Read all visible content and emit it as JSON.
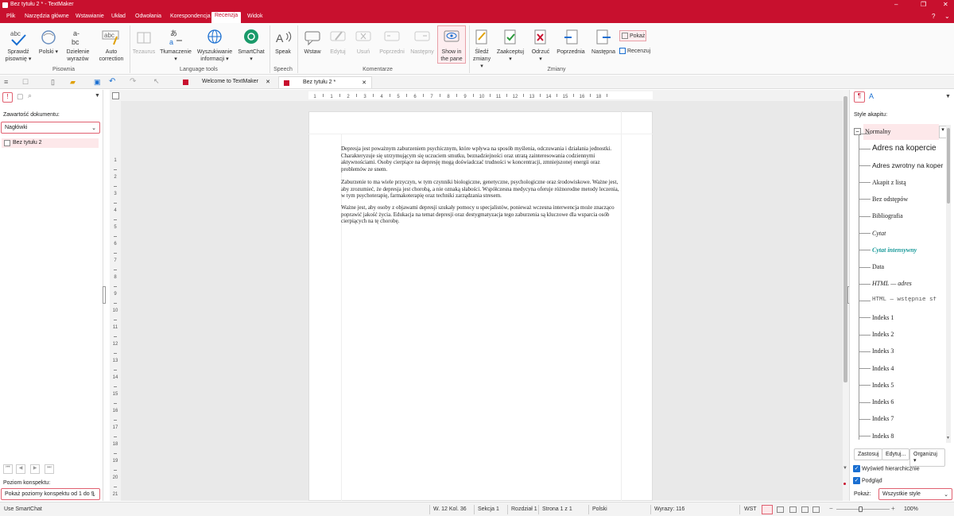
{
  "window": {
    "title": "Bez tytułu 2 * - TextMaker"
  },
  "menu": {
    "tabs": [
      "Plik",
      "Narzędzia główne",
      "Wstawianie",
      "Układ",
      "Odwołania",
      "Korespondencja",
      "Recenzja",
      "Widok"
    ],
    "active": "Recenzja"
  },
  "ribbon": {
    "proofing": {
      "spell_check": "Sprawdź pisownię",
      "language": "Polski",
      "hyphenation": "Dzielenie wyrazów",
      "autocorrect": "Auto correction",
      "group": "Pisownia"
    },
    "language_tools": {
      "thesaurus": "Tezaurus",
      "translate": "Tłumaczenie",
      "research": "Wyszukiwanie informacji",
      "smartchat": "SmartChat",
      "group": "Language tools"
    },
    "speech": {
      "speak": "Speak",
      "group": "Speech"
    },
    "comments": {
      "insert": "Wstaw",
      "edit": "Edytuj",
      "delete": "Usuń",
      "previous": "Poprzedni",
      "next": "Następny",
      "show_in_pane": "Show in the pane",
      "group": "Komentarze"
    },
    "changes": {
      "track": "Śledź zmiany",
      "accept": "Zaakceptuj",
      "reject": "Odrzuć",
      "previous": "Poprzednia",
      "next": "Następna",
      "show": "Pokaż",
      "review": "Recenzuj",
      "group": "Zmiany"
    }
  },
  "tabs": {
    "welcome": "Welcome to TextMaker",
    "doc": "Bez tytułu 2 *"
  },
  "left_panel": {
    "content_label": "Zawartość dokumentu:",
    "content_select": "Nagłówki",
    "tree_item": "Bez tytułu 2",
    "outline_label": "Poziom konspektu:",
    "outline_select": "Pokaż poziomy konspektu od 1 do 9"
  },
  "ruler": {
    "h_labels": [
      "1",
      "1",
      "2",
      "3",
      "4",
      "5",
      "6",
      "7",
      "8",
      "9",
      "10",
      "11",
      "12",
      "13",
      "14",
      "15",
      "16",
      "18"
    ],
    "v_labels": [
      "1",
      "2",
      "3",
      "4",
      "5",
      "6",
      "7",
      "8",
      "9",
      "10",
      "11",
      "12",
      "13",
      "14",
      "15",
      "16",
      "17",
      "18",
      "19",
      "20",
      "21"
    ]
  },
  "document": {
    "paragraphs": [
      "Depresja jest poważnym zaburzeniem psychicznym, które wpływa na sposób myślenia, odczuwania i działania jednostki. Charakteryzuje się utrzymującym się uczuciem smutku, beznadziejności oraz utratą zainteresowania codziennymi aktywnościami. Osoby cierpiące na depresję mogą doświadczać trudności w koncentracji, zmniejszonej energii oraz problemów ze snem.",
      "Zaburzenie to ma wiele przyczyn, w tym czynniki biologiczne, genetyczne, psychologiczne oraz środowiskowe. Ważne jest, aby zrozumieć, że depresja jest chorobą, a nie oznaką słabości. Współczesna medycyna oferuje różnorodne metody leczenia, w tym psychoterapię, farmakoterapię oraz techniki zarządzania stresem.",
      "Ważne jest, aby osoby z objawami depresji szukały pomocy u specjalistów, ponieważ wczesna interwencja może znacząco poprawić jakość życia. Edukacja na temat depresji oraz destygmatyzacja tego zaburzenia są kluczowe dla wsparcia osób cierpiących na tę chorobę."
    ]
  },
  "right_panel": {
    "label": "Style akapitu:",
    "styles": [
      "Normalny",
      "Adres na kopercie",
      "Adres zwrotny na koper",
      "Akapit z listą",
      "Bez odstępów",
      "Bibliografia",
      "Cytat",
      "Cytat intensywny",
      "Data",
      "HTML — adres",
      "HTML — wstępnie sf",
      "Indeks 1",
      "Indeks 2",
      "Indeks 3",
      "Indeks 4",
      "Indeks 5",
      "Indeks 6",
      "Indeks 7",
      "Indeks 8"
    ],
    "apply": "Zastosuj",
    "edit": "Edytuj...",
    "organize": "Organizuj",
    "show_hierarchical": "Wyświetl hierarchicznie",
    "preview": "Podgląd",
    "show_label": "Pokaż:",
    "show_select": "Wszystkie style"
  },
  "status": {
    "smartchat": "Use SmartChat",
    "position": "W. 12 Kol. 36",
    "section": "Sekcja 1",
    "chapter": "Rozdział 1",
    "page": "Strona 1 z 1",
    "language": "Polski",
    "words": "Wyrazy: 116",
    "mode": "WST",
    "zoom": "100%"
  },
  "colors": {
    "brand": "#c8102e",
    "accent": "#1a6fd1"
  }
}
